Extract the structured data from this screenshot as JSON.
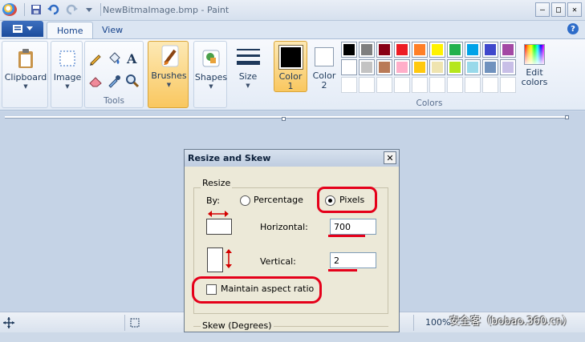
{
  "window": {
    "title": "NewBitmaImage.bmp - Paint"
  },
  "title_controls": {
    "minimize": "–",
    "maximize": "□",
    "close": "✕"
  },
  "tabs": [
    {
      "label": "Home",
      "active": true
    },
    {
      "label": "View",
      "active": false
    }
  ],
  "help": "?",
  "ribbon": {
    "clipboard": {
      "label": "Clipboard"
    },
    "image": {
      "label": "Image"
    },
    "tools": {
      "label": "Tools"
    },
    "brushes": {
      "label": "Brushes"
    },
    "shapes": {
      "label": "Shapes"
    },
    "size": {
      "label": "Size"
    },
    "color1": {
      "label1": "Color",
      "label2": "1",
      "value": "#000000"
    },
    "color2": {
      "label1": "Color",
      "label2": "2",
      "value": "#ffffff"
    },
    "colors": {
      "label": "Colors"
    },
    "edit_colors": {
      "label1": "Edit",
      "label2": "colors"
    },
    "palette": [
      "#000000",
      "#7f7f7f",
      "#880015",
      "#ed1c24",
      "#ff7f27",
      "#fff200",
      "#22b14c",
      "#00a2e8",
      "#3f48cc",
      "#a349a4",
      "#ffffff",
      "#c3c3c3",
      "#b97a57",
      "#ffaec9",
      "#ffc90e",
      "#efe4b0",
      "#b5e61d",
      "#99d9ea",
      "#7092be",
      "#c8bfe7",
      "",
      "",
      "",
      "",
      "",
      "",
      "",
      "",
      "",
      ""
    ]
  },
  "status": {
    "zoom": "100%",
    "watermark": "安全客（bobao.360.cn）"
  },
  "dialog": {
    "title": "Resize and Skew",
    "close": "✕",
    "resize_group": "Resize",
    "by_label": "By:",
    "percentage_label": "Percentage",
    "pixels_label": "Pixels",
    "horizontal_label": "Horizontal:",
    "horizontal_value": "700",
    "vertical_label": "Vertical:",
    "vertical_value": "2",
    "maintain_label": "Maintain aspect ratio",
    "maintain_checked": false,
    "skew_group": "Skew (Degrees)"
  }
}
